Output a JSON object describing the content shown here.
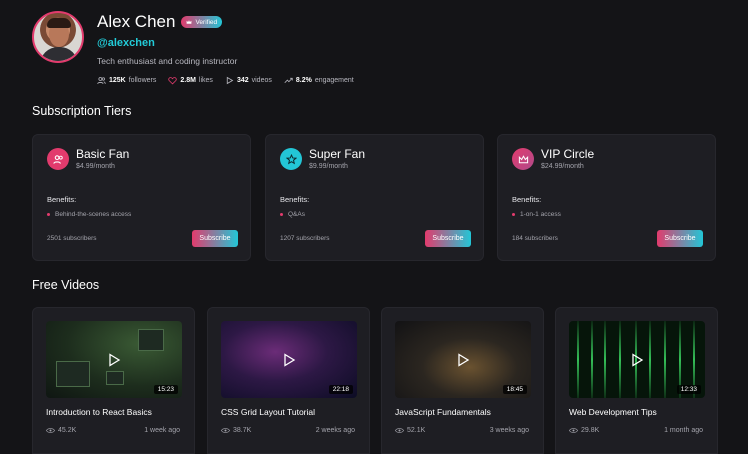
{
  "profile": {
    "name": "Alex Chen",
    "verified_label": "Verified",
    "handle": "@alexchen",
    "bio": "Tech enthusiast and coding instructor",
    "stats": [
      {
        "icon": "users-icon",
        "value": "125K",
        "label": "followers"
      },
      {
        "icon": "heart-icon",
        "value": "2.8M",
        "label": "likes"
      },
      {
        "icon": "play-icon",
        "value": "342",
        "label": "videos"
      },
      {
        "icon": "trending-up-icon",
        "value": "8.2%",
        "label": "engagement"
      }
    ]
  },
  "tiers_section": {
    "title": "Subscription Tiers",
    "tiers": [
      {
        "name": "Basic Fan",
        "price": "$4.99/month",
        "benefits_label": "Benefits:",
        "benefit": "Behind-the-scenes access",
        "subscribers": "2501 subscribers",
        "button": "Subscribe",
        "icon": "users-icon",
        "icon_color": "#e23b6d"
      },
      {
        "name": "Super Fan",
        "price": "$9.99/month",
        "benefits_label": "Benefits:",
        "benefit": "Q&As",
        "subscribers": "1207 subscribers",
        "button": "Subscribe",
        "icon": "star-icon",
        "icon_color": "#23c6d6"
      },
      {
        "name": "VIP Circle",
        "price": "$24.99/month",
        "benefits_label": "Benefits:",
        "benefit": "1-on-1 access",
        "subscribers": "184 subscribers",
        "button": "Subscribe",
        "icon": "crown-icon",
        "icon_color": "#e23b6d"
      }
    ]
  },
  "videos_section": {
    "title": "Free Videos",
    "videos": [
      {
        "title": "Introduction to React Basics",
        "duration": "15:23",
        "views": "45.2K",
        "age": "1 week ago"
      },
      {
        "title": "CSS Grid Layout Tutorial",
        "duration": "22:18",
        "views": "38.7K",
        "age": "2 weeks ago"
      },
      {
        "title": "JavaScript Fundamentals",
        "duration": "18:45",
        "views": "52.1K",
        "age": "3 weeks ago"
      },
      {
        "title": "Web Development Tips",
        "duration": "12:33",
        "views": "29.8K",
        "age": "1 month ago"
      }
    ]
  },
  "colors": {
    "accent_pink": "#e23b6d",
    "accent_cyan": "#23c6d6",
    "background": "#141417"
  }
}
